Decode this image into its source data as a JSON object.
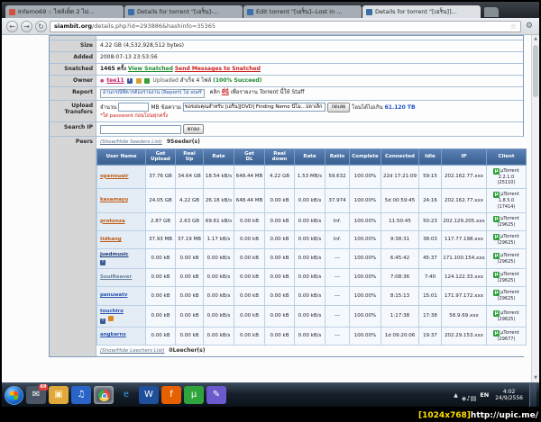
{
  "window": {
    "address_host": "siambit.org",
    "address_path": "/details.php?id=293886&hashinfo=35365",
    "nav": {
      "back": "←",
      "forward": "→",
      "reload": "↻",
      "star": "☆",
      "menu": "⚙"
    },
    "tabs": [
      {
        "label": "Inferno69 :: ไฟล์เด็ด 2 ไม่...",
        "favicon_color": "#d4503c"
      },
      {
        "label": "Details for torrent \"[เอร็น]-...",
        "favicon_color": "#3c6ea8"
      },
      {
        "label": "Edit torrent \"[เอร็น]--Lost in ...",
        "favicon_color": "#3c6ea8"
      },
      {
        "label": "Details for torrent \"[เอร็น]]...",
        "favicon_color": "#3c6ea8",
        "active": true
      }
    ]
  },
  "details": {
    "size": {
      "label": "Size",
      "value": "4.22 GB (4,532,928,512 bytes)"
    },
    "added": {
      "label": "Added",
      "value": "2008-07-13 23:53:56"
    },
    "snatched": {
      "label": "Snatched",
      "count": "1465 ครั้ง",
      "view_link": "View Snatched",
      "send_link": "Send Messages to Snatched"
    },
    "owner": {
      "label": "Owner",
      "name": "tee11",
      "uploaded_text": "Uploaded",
      "success_text": "สำเร็จ 4 ไฟล์",
      "success_percent": "(100% Succeed)"
    },
    "report": {
      "label": "Report",
      "link_text": "อ่านกรณีที่ควรต้องรายงาน (Report) ไม่ staff",
      "hint_prefix": "คลิก",
      "hint_link": "ที่นี่",
      "hint_suffix": "เพื่อรายงาน Torrent นี้ให้ Staff"
    },
    "upload_transfers": {
      "label": "Upload Transfers",
      "amount_label": "จำนวน",
      "amount_unit": "MB",
      "message_label": "ข้อความ",
      "message_value": "ขอขอบคุณสำหรับ [เอร็น][DVD] Finding Nemo นีโม...ปลาเล็ก",
      "button": "กดเลย",
      "limit_prefix": "โอนได้ไม่เกิน",
      "limit_value": "61.120 TB",
      "note": "*ใส่ password ก่อนโอนทุกครั้ง"
    },
    "search_ip": {
      "label": "Search IP",
      "button": "ตกลง"
    },
    "peers": {
      "label": "Peers",
      "seeders_toggle": "(Show/Hide Seeders List)",
      "seeders_count": "9Seeder(s)",
      "leechers_toggle": "(Show/Hide Leechers List)",
      "leechers_count": "0Leecher(s)"
    }
  },
  "peers_table": {
    "headers": [
      "User Name",
      "Get\nUpload",
      "Real\nUp",
      "Rate",
      "Get\nDL",
      "Real\ndown",
      "Rate",
      "Ratio",
      "Complete",
      "Connected",
      "Idle",
      "IP",
      "Client"
    ],
    "rows": [
      {
        "user": "opennuair",
        "user_color": "#c05a14",
        "get_up": "37.76 GB",
        "real_up": "34.64 GB",
        "rate_up": "18.54 kB/s",
        "get_dl": "648.44 MB",
        "real_down": "4.22 GB",
        "rate_down": "1.53 MB/s",
        "ratio": "59.632",
        "complete": "100.00%",
        "connected": "22d 17:21:09",
        "idle": "59:15",
        "ip": "202.162.77.xxx",
        "client": "µTorrent 2.2.1.0",
        "port": "(25110)"
      },
      {
        "user": "kasamayu",
        "user_color": "#c05a14",
        "get_up": "24.05 GB",
        "real_up": "4.22 GB",
        "rate_up": "26.18 kB/s",
        "get_dl": "648.44 MB",
        "real_down": "0.00 kB",
        "rate_down": "0.00 kB/s",
        "ratio": "37.974",
        "complete": "100.00%",
        "connected": "5d 00:59:45",
        "idle": "24:16",
        "ip": "202.162.77.xxx",
        "client": "µTorrent 1.8.5.0",
        "port": "(17414)"
      },
      {
        "user": "protonza",
        "user_color": "#c05a14",
        "get_up": "2.87 GB",
        "real_up": "2.63 GB",
        "rate_up": "69.61 kB/s",
        "get_dl": "0.00 kB",
        "real_down": "0.00 kB",
        "rate_down": "0.00 kB/s",
        "ratio": "Inf.",
        "complete": "100.00%",
        "connected": "11:50:45",
        "idle": "50:23",
        "ip": "202.129.205.xxx",
        "client": "µTorrent",
        "port": "(29625)"
      },
      {
        "user": "tidkang",
        "user_color": "#c05a14",
        "get_up": "37.93 MB",
        "real_up": "37.19 MB",
        "rate_up": "1.17 kB/s",
        "get_dl": "0.00 kB",
        "real_down": "0.00 kB",
        "rate_down": "0.00 kB/s",
        "ratio": "Inf.",
        "complete": "100.00%",
        "connected": "9:38:31",
        "idle": "38:03",
        "ip": "117.77.198.xxx",
        "client": "µTorrent",
        "port": "(29625)"
      },
      {
        "user": "juedmusic",
        "user_color": "#1b3c78",
        "has_fb": true,
        "get_up": "0.00 kB",
        "real_up": "0.00 kB",
        "rate_up": "0.00 kB/s",
        "get_dl": "0.00 kB",
        "real_down": "0.00 kB",
        "rate_down": "0.00 kB/s",
        "ratio": "---",
        "complete": "100.00%",
        "connected": "6:45:42",
        "idle": "45:37",
        "ip": "171.100.154.xxx",
        "client": "µTorrent",
        "port": "(29625)"
      },
      {
        "user": "SoulReaver",
        "user_color": "#64819e",
        "get_up": "0.00 kB",
        "real_up": "0.00 kB",
        "rate_up": "0.00 kB/s",
        "get_dl": "0.00 kB",
        "real_down": "0.00 kB",
        "rate_down": "0.00 kB/s",
        "ratio": "---",
        "complete": "100.00%",
        "connected": "7:08:36",
        "idle": "7:40",
        "ip": "124.122.33.xxx",
        "client": "µTorrent",
        "port": "(29625)"
      },
      {
        "user": "panuwatv",
        "user_color": "#2a52b0",
        "get_up": "0.00 kB",
        "real_up": "0.00 kB",
        "rate_up": "0.00 kB/s",
        "get_dl": "0.00 kB",
        "real_down": "0.00 kB",
        "rate_down": "0.00 kB/s",
        "ratio": "---",
        "complete": "100.00%",
        "connected": "8:15:13",
        "idle": "15:01",
        "ip": "171.97.172.xxx",
        "client": "µTorrent",
        "port": "(29625)"
      },
      {
        "user": "touchiro",
        "user_color": "#2a52b0",
        "has_fb": true,
        "has_extra": true,
        "get_up": "0.00 kB",
        "real_up": "0.00 kB",
        "rate_up": "0.00 kB/s",
        "get_dl": "0.00 kB",
        "real_down": "0.00 kB",
        "rate_down": "0.00 kB/s",
        "ratio": "---",
        "complete": "100.00%",
        "connected": "1:17:38",
        "idle": "17:38",
        "ip": "58.9.69.xxx",
        "client": "µTorrent",
        "port": "(29625)"
      },
      {
        "user": "angkarns",
        "user_color": "#2a52b0",
        "get_up": "0.00 kB",
        "real_up": "0.00 kB",
        "rate_up": "0.00 kB/s",
        "get_dl": "0.00 kB",
        "real_down": "0.00 kB",
        "rate_down": "0.00 kB/s",
        "ratio": "---",
        "complete": "100.00%",
        "connected": "1d 09:20:06",
        "idle": "19:37",
        "ip": "202.29.153.xxx",
        "client": "µTorrent",
        "port": "(29677)"
      }
    ]
  },
  "icons": {
    "facebook_glyph": "f",
    "utorrent_glyph": "µ",
    "scroll_up": "▲",
    "scroll_down": "▼",
    "tray_expand": "▲",
    "owner_user_glyph": "●"
  },
  "taskbar": {
    "icons": [
      {
        "name": "chat-app-icon",
        "glyph": "✉",
        "glyph_color": "#ffffff",
        "bg": "#4a5663",
        "badge": "69"
      },
      {
        "name": "explorer-icon",
        "glyph": "▣",
        "glyph_color": "#fff3cc",
        "bg": "#e0a83c"
      },
      {
        "name": "media-player-icon",
        "glyph": "♫",
        "glyph_color": "#ffffff",
        "bg": "#2a64c8"
      },
      {
        "name": "chrome-icon",
        "glyph": "",
        "bg": "rgba(255,255,255,0.25)",
        "is_chrome": true,
        "active": true
      },
      {
        "name": "ie-icon",
        "glyph": "e",
        "glyph_color": "#35a3e8",
        "bg": "transparent"
      },
      {
        "name": "office-icon",
        "glyph": "W",
        "glyph_color": "#ffffff",
        "bg": "#1f4e9a"
      },
      {
        "name": "firefox-icon",
        "glyph": "f",
        "glyph_color": "#ffffff",
        "bg": "#e66000"
      },
      {
        "name": "utorrent-icon",
        "glyph": "µ",
        "glyph_color": "#ffffff",
        "bg": "#2fa33c"
      },
      {
        "name": "paint-icon",
        "glyph": "✎",
        "glyph_color": "#ffffff",
        "bg": "#6a5acd"
      }
    ],
    "tray_icons": [
      "◈",
      "♪",
      "▤"
    ],
    "language": "EN",
    "time": "4:02",
    "date": "24/9/2556"
  },
  "watermark": {
    "resolution": "[1024x768]",
    "url": "http://upic.me/"
  }
}
